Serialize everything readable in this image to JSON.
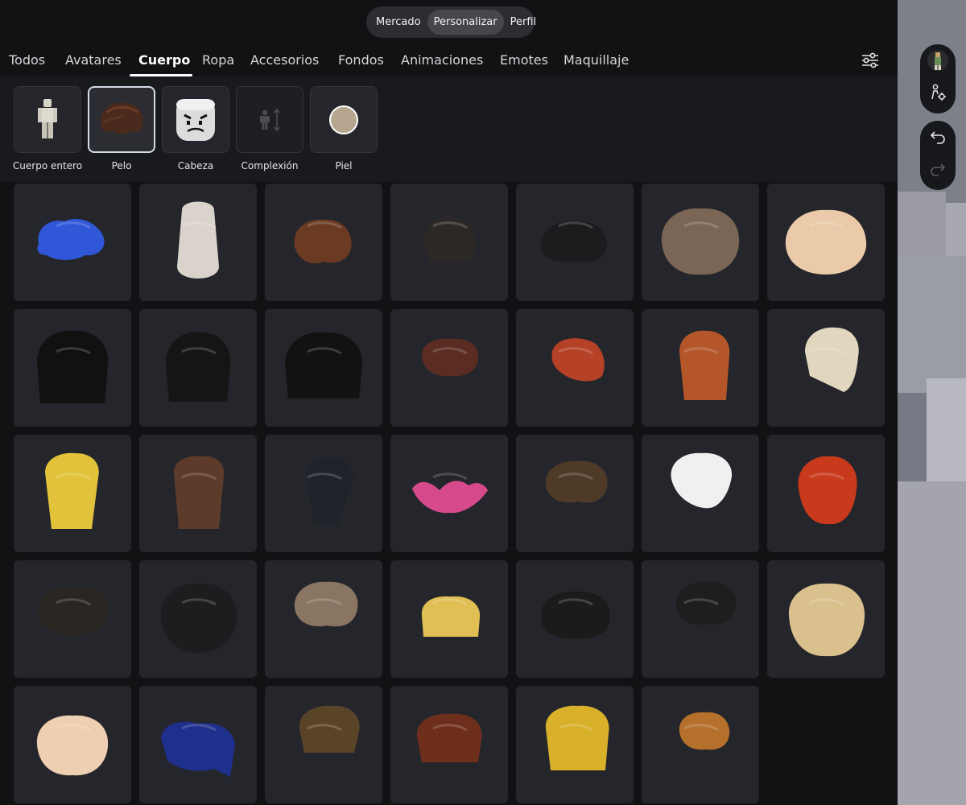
{
  "top_nav": {
    "items": [
      {
        "label": "Mercado",
        "active": false
      },
      {
        "label": "Personalizar",
        "active": true
      },
      {
        "label": "Perfil",
        "active": false
      }
    ]
  },
  "tabs": [
    {
      "label": "Todos",
      "active": false
    },
    {
      "label": "Avatares",
      "active": false
    },
    {
      "label": "Cuerpo",
      "active": true
    },
    {
      "label": "Ropa",
      "active": false
    },
    {
      "label": "Accesorios",
      "active": false
    },
    {
      "label": "Fondos",
      "active": false
    },
    {
      "label": "Animaciones",
      "active": false
    },
    {
      "label": "Emotes",
      "active": false
    },
    {
      "label": "Maquillaje",
      "active": false
    }
  ],
  "filter_icon": "sliders-icon",
  "subcategories": [
    {
      "label": "Cuerpo entero",
      "icon": "full-body-icon",
      "active": false
    },
    {
      "label": "Pelo",
      "icon": "hair-icon",
      "active": true
    },
    {
      "label": "Cabeza",
      "icon": "head-icon",
      "active": false
    },
    {
      "label": "Complexión",
      "icon": "body-scale-icon",
      "active": false
    },
    {
      "label": "Piel",
      "icon": "skin-color-icon",
      "active": false
    }
  ],
  "skin_color": "#b7a58f",
  "hair_items": [
    {
      "name": "blue-spiky-hair",
      "color": "#2f57d8"
    },
    {
      "name": "long-white-hair",
      "color": "#d9d3cb"
    },
    {
      "name": "brown-messy-hair",
      "color": "#6a3a23"
    },
    {
      "name": "dark-bob-hair",
      "color": "#2c2825"
    },
    {
      "name": "black-spiky-hair",
      "color": "#1c1c1e"
    },
    {
      "name": "brown-fluffy-hair",
      "color": "#7b6555"
    },
    {
      "name": "blonde-ahoge-hair",
      "color": "#eacaa8"
    },
    {
      "name": "black-emo-hair",
      "color": "#111111"
    },
    {
      "name": "black-layered-hair",
      "color": "#151515"
    },
    {
      "name": "black-shaggy-hair",
      "color": "#121212"
    },
    {
      "name": "brown-ponytail-hair",
      "color": "#5a2c22"
    },
    {
      "name": "red-swept-hair",
      "color": "#b54226"
    },
    {
      "name": "ginger-long-hair",
      "color": "#b4562a"
    },
    {
      "name": "platinum-bob-hair",
      "color": "#e1d7bf"
    },
    {
      "name": "yellow-long-hair",
      "color": "#e2c23a"
    },
    {
      "name": "beanie-brown-hair",
      "color": "#5c3b2a"
    },
    {
      "name": "black-side-ponytail",
      "color": "#20222a"
    },
    {
      "name": "flower-pigtails",
      "color": "#d64a8c"
    },
    {
      "name": "brown-fringe-hair",
      "color": "#4f3a28"
    },
    {
      "name": "white-spiky-hair",
      "color": "#f0f0f0"
    },
    {
      "name": "red-curly-hair",
      "color": "#c93a1c"
    },
    {
      "name": "dark-puffy-hair",
      "color": "#2a2622"
    },
    {
      "name": "black-chain-hair",
      "color": "#1d1d1f"
    },
    {
      "name": "ash-brown-hair",
      "color": "#8a7563"
    },
    {
      "name": "golden-bob-hair",
      "color": "#e0bf55"
    },
    {
      "name": "black-wavy-hair",
      "color": "#1b1b1c"
    },
    {
      "name": "black-curtain-hair",
      "color": "#1e1e1f"
    },
    {
      "name": "blonde-blue-head",
      "color": "#d9c08c"
    },
    {
      "name": "peach-fluffy-hair",
      "color": "#efcfb1"
    },
    {
      "name": "navy-swept-hair",
      "color": "#1f2f8c"
    },
    {
      "name": "brown-slick-hair",
      "color": "#5a4428"
    },
    {
      "name": "auburn-spiky-hair",
      "color": "#6e2e1c"
    },
    {
      "name": "gold-spiky-hair",
      "color": "#d9b02a"
    },
    {
      "name": "orange-messy-hair",
      "color": "#b5702b"
    }
  ],
  "viewport": {
    "avatar_thumb_icon": "avatar-thumbnail-icon",
    "avatar_settings_icon": "avatar-settings-icon",
    "undo_icon": "undo-icon",
    "redo_icon": "redo-icon"
  }
}
